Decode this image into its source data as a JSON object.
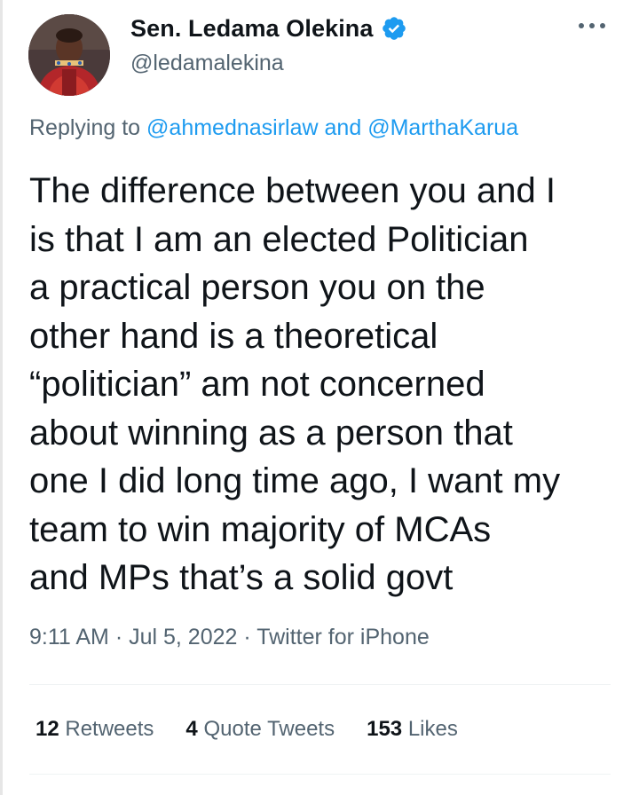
{
  "author": {
    "display_name": "Sen. Ledama Olekina",
    "handle": "@ledamalekina",
    "verified": true,
    "avatar_icon": "profile-photo"
  },
  "reply": {
    "prefix": "Replying to",
    "mention_1": "@ahmednasirlaw",
    "joiner": "and",
    "mention_2": "@MarthaKarua"
  },
  "tweet": {
    "lines": [
      "The difference between you and I",
      "is that I am an elected Politician",
      "a practical person you on the",
      "other hand is a theoretical",
      "“politician” am not concerned",
      "about winning as a person that",
      "one I did long time ago, I want my",
      "team to win majority of MCAs",
      "and MPs that’s a solid govt"
    ]
  },
  "meta": {
    "time": "9:11 AM",
    "separator": "·",
    "date": "Jul 5, 2022",
    "source": "Twitter for iPhone"
  },
  "stats": {
    "retweets_count": "12",
    "retweets_label": "Retweets",
    "quotes_count": "4",
    "quotes_label": "Quote Tweets",
    "likes_count": "153",
    "likes_label": "Likes"
  },
  "colors": {
    "accent": "#1d9bf0",
    "text": "#0f1419",
    "secondary": "#536471",
    "divider": "#eff3f4"
  }
}
